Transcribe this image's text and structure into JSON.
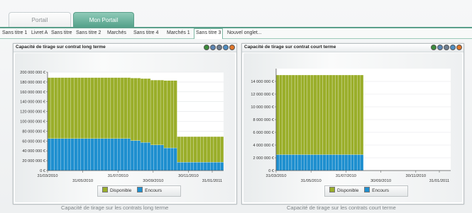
{
  "portal_tabs": [
    {
      "label": "Portail",
      "active": false
    },
    {
      "label": "Mon Portail",
      "active": true
    }
  ],
  "sub_tabs": [
    {
      "label": "Sans titre 1",
      "active": false
    },
    {
      "label": "Livret A",
      "active": false
    },
    {
      "label": "Sans titre",
      "active": false
    },
    {
      "label": "Sans titre 2",
      "active": false
    },
    {
      "label": "Marchés",
      "active": false
    },
    {
      "label": "Sans titre 4",
      "active": false
    },
    {
      "label": "Marchés 1",
      "active": false
    },
    {
      "label": "Sans titre 3",
      "active": true
    },
    {
      "label": "Nouvel onglet...",
      "active": false
    }
  ],
  "widget_icons": [
    "refresh-icon",
    "chart-icon",
    "settings-icon",
    "maximize-icon",
    "close-icon"
  ],
  "colors": {
    "disponible": "#9aae2a",
    "encours": "#1e8fcf",
    "accent": "#5a9f8a"
  },
  "widgets": [
    {
      "title": "Capacité de tirage sur contrat long terme",
      "caption": "Capacité de tirage sur les contrats long terme",
      "legend": [
        "Disponible",
        "Encours"
      ]
    },
    {
      "title": "Capacité de tirage sur contrat court terme",
      "caption": "Capacité de tirage sur les contrats court terme",
      "legend": [
        "Disponible",
        "Encours"
      ]
    }
  ],
  "chart_data": [
    {
      "type": "bar",
      "stacked": true,
      "title": "",
      "ylabel": "",
      "xlabel": "",
      "ylim": [
        0,
        200000000
      ],
      "y_ticks": [
        "0 €",
        "20 000 000 €",
        "40 000 000 €",
        "60 000 000 €",
        "80 000 000 €",
        "100 000 000 €",
        "120 000 000 €",
        "140 000 000 €",
        "160 000 000 €",
        "180 000 000 €",
        "200 000 000 €"
      ],
      "x_ticks_row1": [
        "31/03/2010",
        "31/07/2010",
        "30/11/2010"
      ],
      "x_ticks_row2": [
        "31/05/2010",
        "30/09/2010",
        "31/01/2011"
      ],
      "legend_position": "bottom",
      "grid": true,
      "bar_groups": [
        {
          "count": 25,
          "encours": 65000000,
          "disponible": 124000000
        },
        {
          "count": 3,
          "encours": 61000000,
          "disponible": 127000000
        },
        {
          "count": 3,
          "encours": 57000000,
          "disponible": 130000000
        },
        {
          "count": 4,
          "encours": 52000000,
          "disponible": 132000000
        },
        {
          "count": 4,
          "encours": 46000000,
          "disponible": 137000000
        },
        {
          "count": 14,
          "encours": 17000000,
          "disponible": 52000000
        }
      ],
      "series": [
        {
          "name": "Disponible"
        },
        {
          "name": "Encours"
        }
      ]
    },
    {
      "type": "bar",
      "stacked": true,
      "title": "",
      "ylabel": "",
      "xlabel": "",
      "ylim": [
        0,
        16000000
      ],
      "y_ticks": [
        "0 €",
        "2 000 000 €",
        "4 000 000 €",
        "6 000 000 €",
        "8 000 000 €",
        "10 000 000 €",
        "12 000 000 €",
        "14 000 000 €"
      ],
      "x_ticks_row1": [
        "31/03/2010",
        "31/07/2010",
        "30/11/2010"
      ],
      "x_ticks_row2": [
        "31/05/2010",
        "30/09/2010",
        "31/01/2011"
      ],
      "legend_position": "bottom",
      "grid": true,
      "bar_groups": [
        {
          "count": 28,
          "encours": 2500000,
          "disponible": 12500000
        },
        {
          "count": 28,
          "encours": 0,
          "disponible": 0
        }
      ],
      "series": [
        {
          "name": "Disponible"
        },
        {
          "name": "Encours"
        }
      ]
    }
  ]
}
